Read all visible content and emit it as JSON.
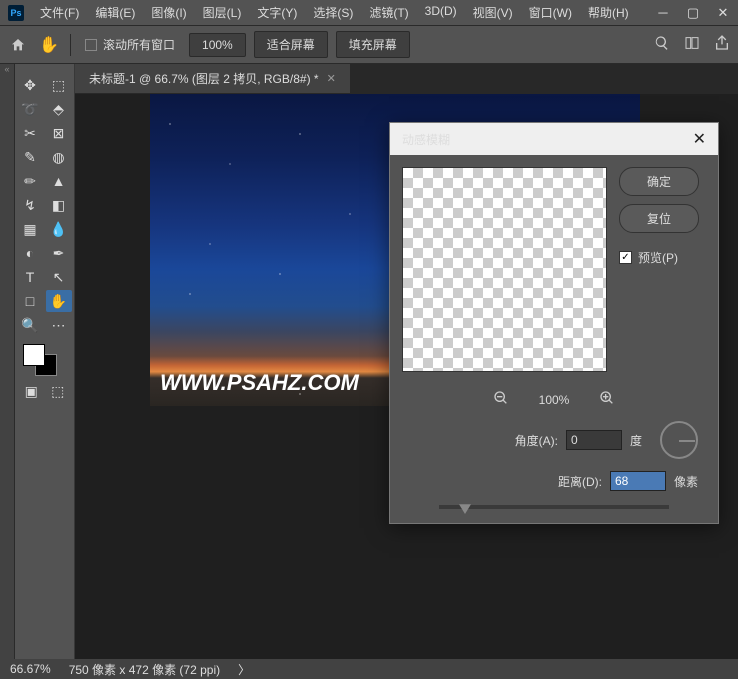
{
  "app": {
    "icon_text": "Ps"
  },
  "menu": {
    "file": "文件(F)",
    "edit": "编辑(E)",
    "image": "图像(I)",
    "layer": "图层(L)",
    "type": "文字(Y)",
    "select": "选择(S)",
    "filter": "滤镜(T)",
    "threed": "3D(D)",
    "view": "视图(V)",
    "window": "窗口(W)",
    "help": "帮助(H)"
  },
  "optbar": {
    "scroll_all": "滚动所有窗口",
    "zoom": "100%",
    "fit": "适合屏幕",
    "fill": "填充屏幕"
  },
  "tab": {
    "title": "未标题-1 @ 66.7% (图层 2 拷贝, RGB/8#) *"
  },
  "watermark": "WWW.PSAHZ.COM",
  "dialog": {
    "title": "动感模糊",
    "ok": "确定",
    "reset": "复位",
    "preview": "预览(P)",
    "zoom": "100%",
    "angle_label": "角度(A):",
    "angle_val": "0",
    "angle_unit": "度",
    "dist_label": "距离(D):",
    "dist_val": "68",
    "dist_unit": "像素"
  },
  "status": {
    "zoom": "66.67%",
    "dims": "750 像素 x 472 像素 (72 ppi)"
  }
}
